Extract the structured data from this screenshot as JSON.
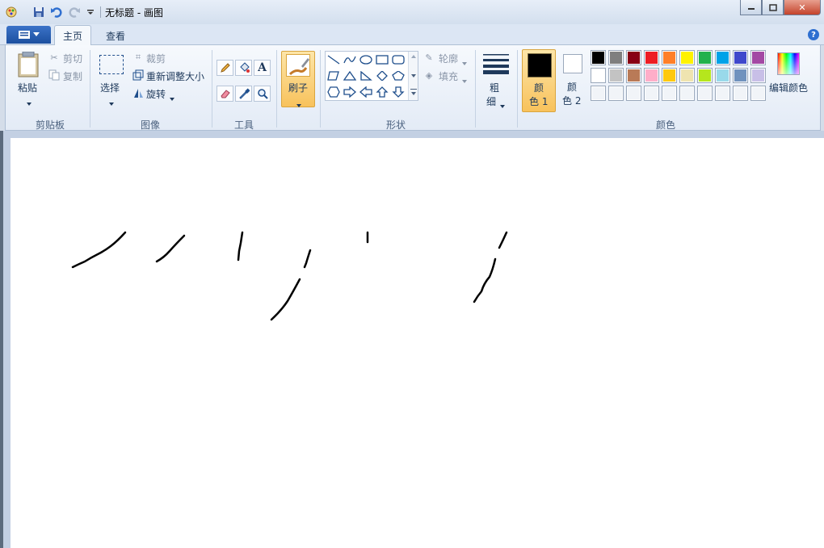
{
  "window": {
    "title": "无标题 - 画图",
    "min_symbol": "▬",
    "max_symbol": "▢",
    "close_symbol": "✕"
  },
  "tabs": {
    "home": "主页",
    "view": "查看"
  },
  "clipboard": {
    "paste": "粘贴",
    "cut": "剪切",
    "copy": "复制",
    "group": "剪贴板"
  },
  "image": {
    "select": "选择",
    "crop": "裁剪",
    "resize": "重新调整大小",
    "rotate": "旋转",
    "group": "图像"
  },
  "tools": {
    "group": "工具",
    "text_glyph": "A"
  },
  "brushes": {
    "label": "刷子"
  },
  "shapes": {
    "outline": "轮廓",
    "fill": "填充",
    "group": "形状"
  },
  "size": {
    "line1": "粗",
    "line2": "细"
  },
  "colors": {
    "color1_line1": "颜",
    "color1_line2": "色 1",
    "color2_line1": "颜",
    "color2_line2": "色 2",
    "edit": "编辑颜色",
    "group": "颜色",
    "color1_value": "#000000",
    "color2_value": "#ffffff",
    "palette_row1": [
      "#000000",
      "#7f7f7f",
      "#880015",
      "#ed1c24",
      "#ff7f27",
      "#fff200",
      "#22b14c",
      "#00a2e8",
      "#3f48cc",
      "#a349a4"
    ],
    "palette_row2": [
      "#ffffff",
      "#c3c3c3",
      "#b97a57",
      "#ffaec9",
      "#ffc90e",
      "#efe4b0",
      "#b5e61d",
      "#99d9ea",
      "#7092be",
      "#c8bfe7"
    ],
    "palette_row3": [
      "",
      "",
      "",
      "",
      "",
      "",
      "",
      "",
      "",
      ""
    ]
  },
  "help": "?"
}
